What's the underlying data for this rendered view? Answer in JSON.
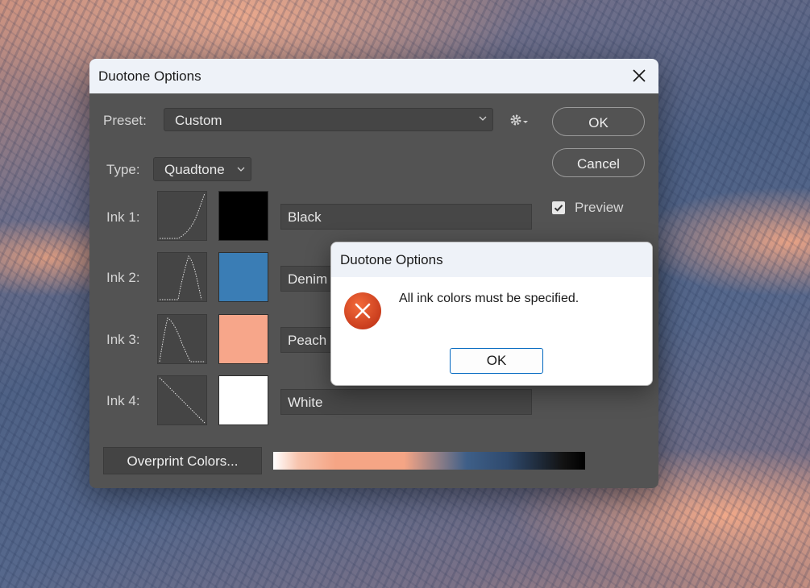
{
  "dialog": {
    "title": "Duotone Options",
    "preset_label": "Preset:",
    "preset_value": "Custom",
    "type_label": "Type:",
    "type_value": "Quadtone",
    "ok_label": "OK",
    "cancel_label": "Cancel",
    "preview_label": "Preview",
    "preview_checked": true,
    "overprint_label": "Overprint Colors...",
    "inks": [
      {
        "label": "Ink 1:",
        "name": "Black",
        "color": "#000000",
        "curve": "rising-late"
      },
      {
        "label": "Ink 2:",
        "name": "Denim",
        "color": "#3a7db5",
        "curve": "peak-middle"
      },
      {
        "label": "Ink 3:",
        "name": "Peach",
        "color": "#f7a68a",
        "curve": "peak-early"
      },
      {
        "label": "Ink 4:",
        "name": "White",
        "color": "#ffffff",
        "curve": "linear-falling"
      }
    ]
  },
  "alert": {
    "title": "Duotone Options",
    "message": "All ink colors must be specified.",
    "ok_label": "OK",
    "icon": "error-icon"
  }
}
